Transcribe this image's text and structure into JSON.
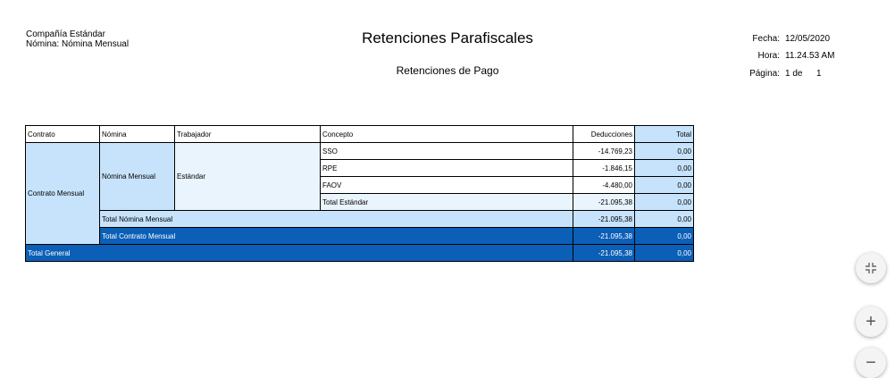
{
  "header": {
    "company": "Compañía Estándar",
    "payroll": "Nómina: Nómina Mensual",
    "title": "Retenciones Parafiscales",
    "subtitle": "Retenciones de Pago",
    "date_label": "Fecha:",
    "date_value": "12/05/2020",
    "time_label": "Hora:",
    "time_value": "11.24.53 AM",
    "page_label": "Página:",
    "page_value": "1 de",
    "page_total": "1"
  },
  "table": {
    "columns": [
      "Contrato",
      "Nómina",
      "Trabajador",
      "Concepto",
      "Deducciones",
      "Total"
    ],
    "contrato": "Contrato Mensual",
    "nomina": "Nómina Mensual",
    "trabajador": "Estándar",
    "rows": [
      {
        "concepto": "SSO",
        "deducciones": "-14.769,23",
        "total": "0,00"
      },
      {
        "concepto": "RPE",
        "deducciones": "-1.846,15",
        "total": "0,00"
      },
      {
        "concepto": "FAOV",
        "deducciones": "-4.480,00",
        "total": "0,00"
      },
      {
        "concepto": "Total Estándar",
        "deducciones": "-21.095,38",
        "total": "0,00"
      }
    ],
    "total_nomina": {
      "label": "Total Nómina Mensual",
      "deducciones": "-21.095,38",
      "total": "0,00"
    },
    "total_contrato": {
      "label": "Total Contrato Mensual",
      "deducciones": "-21.095,38",
      "total": "0,00"
    },
    "total_general": {
      "label": "Total General",
      "deducciones": "-21.095,38",
      "total": "0,00"
    }
  },
  "controls": {
    "fit_icon": "collapse-icon",
    "zoom_in": "+",
    "zoom_out": "−"
  }
}
